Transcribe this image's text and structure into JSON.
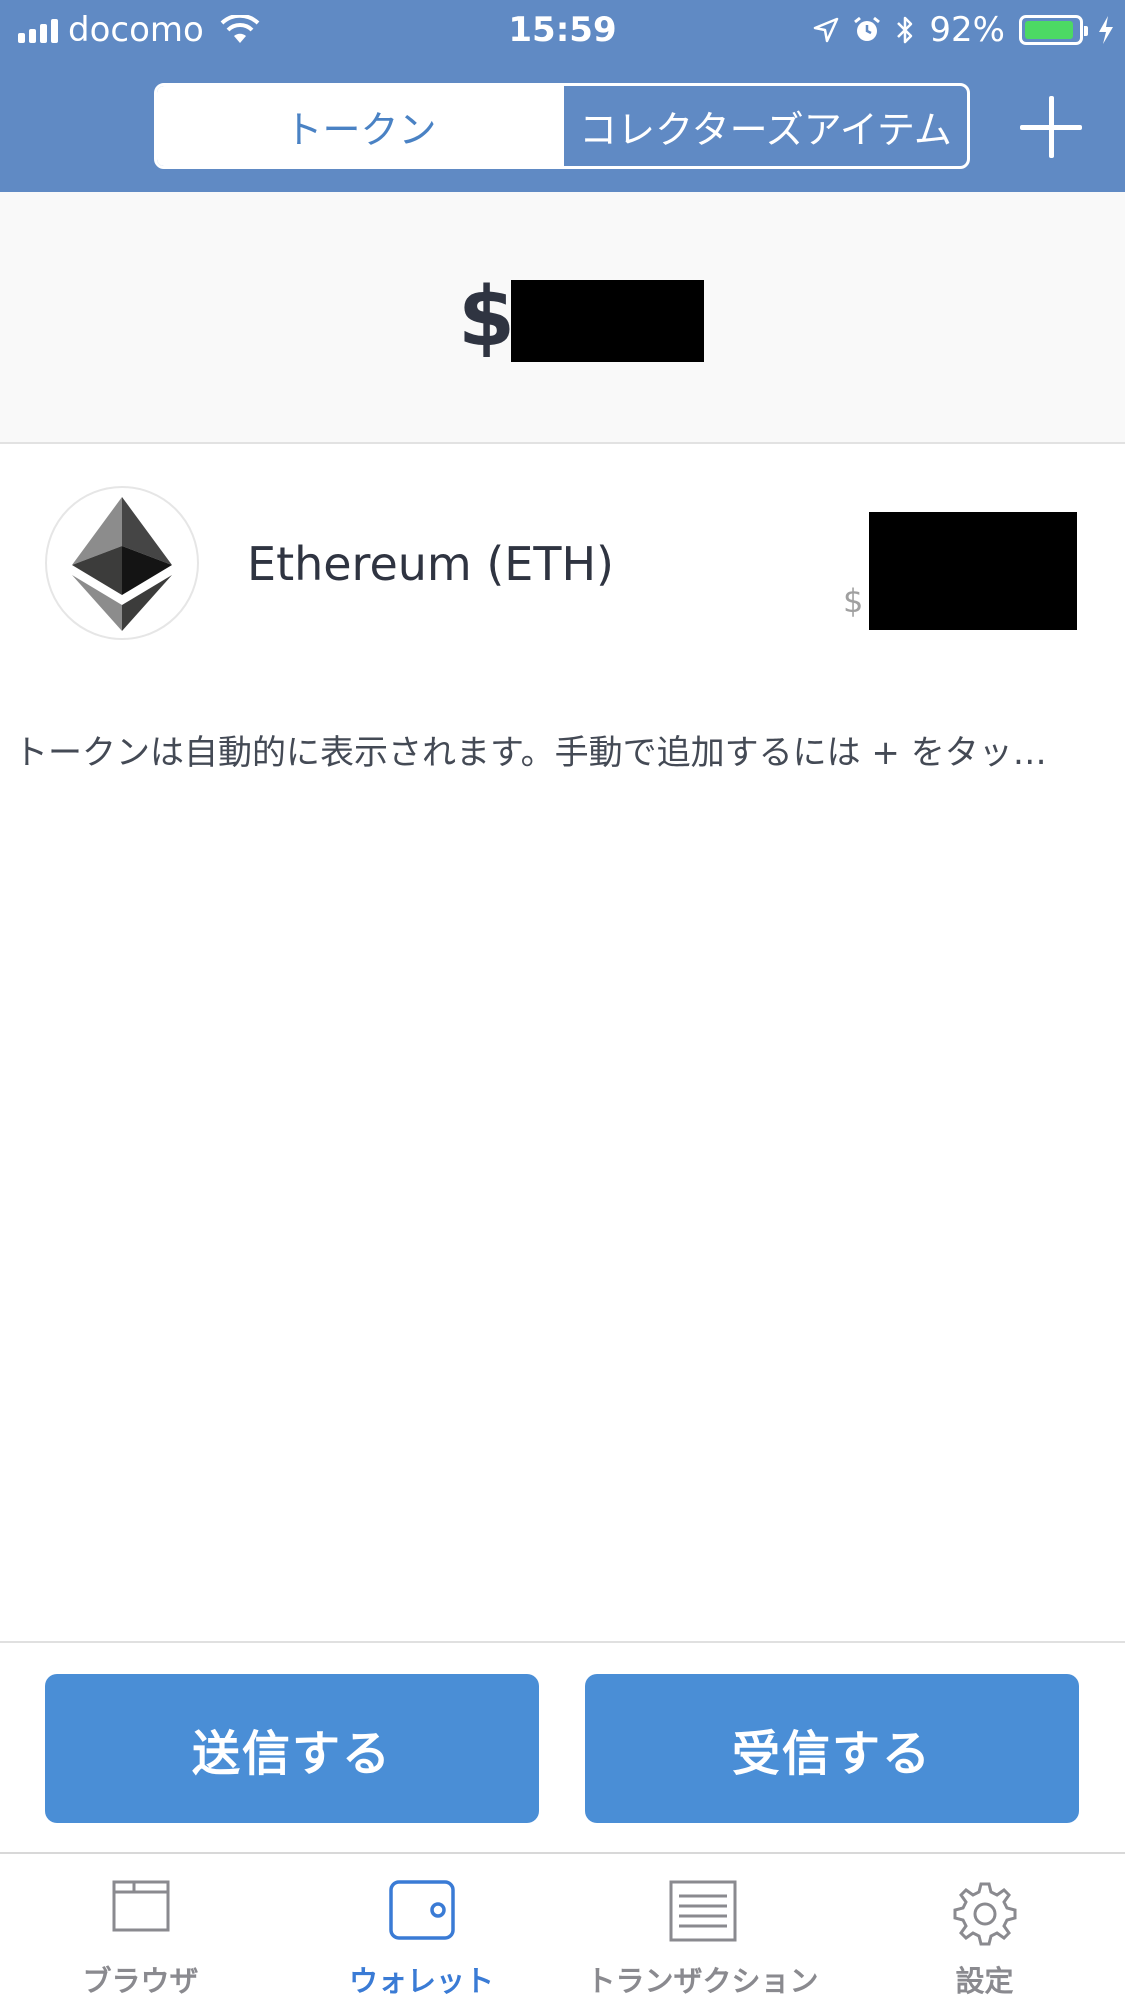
{
  "status_bar": {
    "carrier": "docomo",
    "time": "15:59",
    "battery_percent": "92%",
    "battery_level": 0.92,
    "icons": [
      "signal-icon",
      "wifi-icon",
      "location-icon",
      "alarm-icon",
      "bluetooth-icon",
      "battery-icon",
      "charging-icon"
    ]
  },
  "header": {
    "segments": [
      {
        "label": "トークン",
        "selected": true
      },
      {
        "label": "コレクターズアイテム",
        "selected": false
      }
    ],
    "add_icon": "plus-icon"
  },
  "balance": {
    "currency_symbol": "$",
    "amount_redacted": true
  },
  "tokens": [
    {
      "name": "Ethereum (ETH)",
      "icon": "ethereum-logo-icon",
      "usd_symbol": "$",
      "value_redacted": true
    }
  ],
  "token_hint": "トークンは自動的に表示されます。手動で追加するには + をタッ…",
  "actions": {
    "send_label": "送信する",
    "receive_label": "受信する"
  },
  "tab_bar": {
    "tabs": [
      {
        "label": "ブラウザ",
        "icon": "browser-icon",
        "active": false
      },
      {
        "label": "ウォレット",
        "icon": "wallet-icon",
        "active": true
      },
      {
        "label": "トランザクション",
        "icon": "transactions-icon",
        "active": false
      },
      {
        "label": "設定",
        "icon": "settings-gear-icon",
        "active": false
      }
    ]
  },
  "colors": {
    "header": "#608ac4",
    "accent": "#4a8ed6",
    "active_tab": "#3a7bd5",
    "inactive_tab": "#8a8a8f"
  }
}
